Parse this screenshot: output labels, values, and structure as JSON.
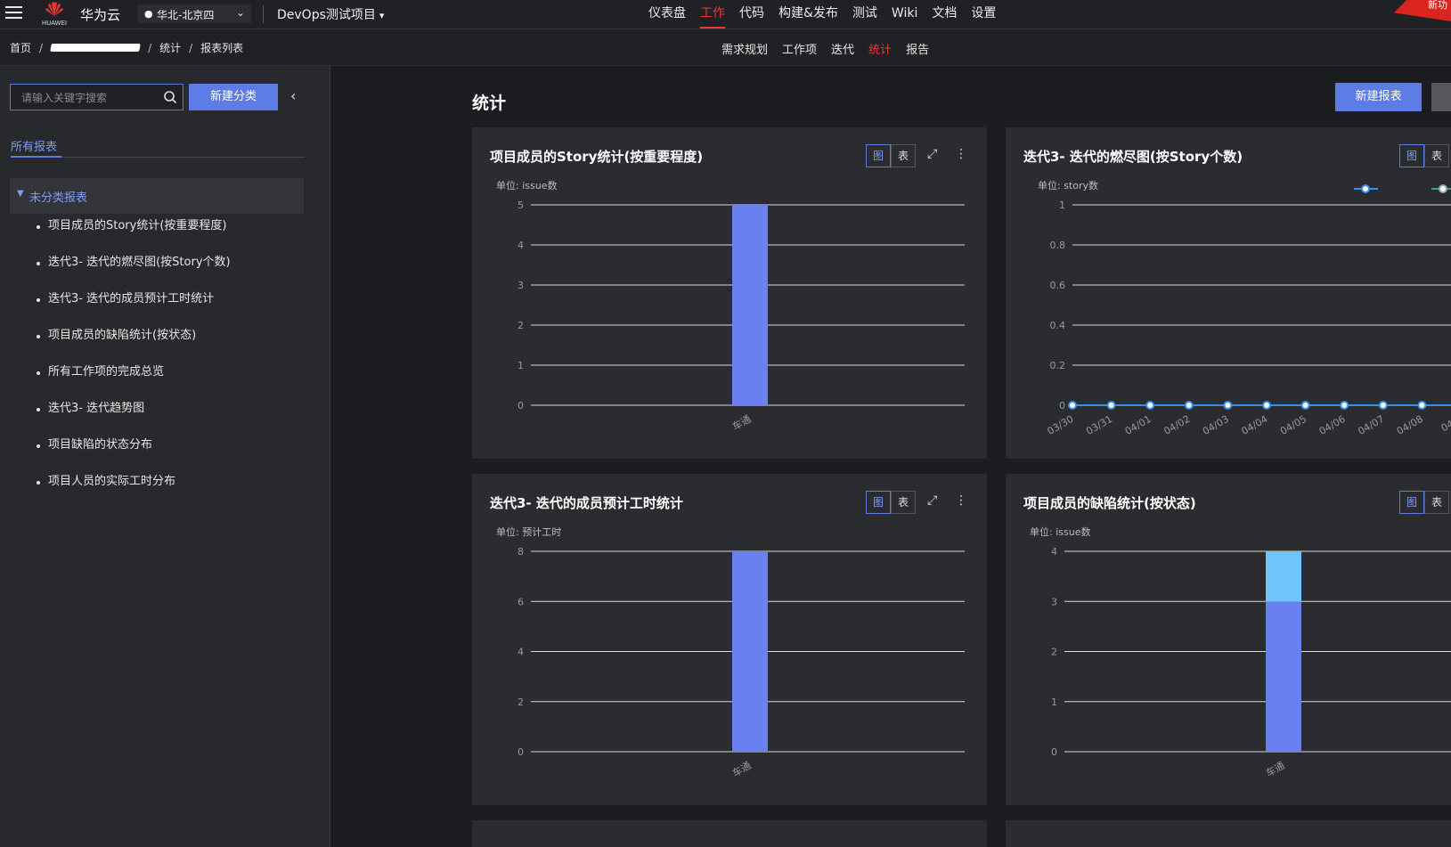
{
  "topbar": {
    "brand": "华为云",
    "logo_text": "HUAWEI",
    "region": "华北-北京四",
    "project": "DevOps测试项目",
    "nav": [
      {
        "label": "仪表盘",
        "active": false
      },
      {
        "label": "工作",
        "active": true
      },
      {
        "label": "代码",
        "active": false
      },
      {
        "label": "构建&发布",
        "active": false
      },
      {
        "label": "测试",
        "active": false
      },
      {
        "label": "Wiki",
        "active": false
      },
      {
        "label": "文档",
        "active": false
      },
      {
        "label": "设置",
        "active": false
      }
    ],
    "badge": "新功"
  },
  "breadcrumb": [
    "首页",
    "统计",
    "报表列表"
  ],
  "subnav": [
    {
      "label": "需求规划",
      "active": false
    },
    {
      "label": "工作项",
      "active": false
    },
    {
      "label": "迭代",
      "active": false
    },
    {
      "label": "统计",
      "active": true
    },
    {
      "label": "报告",
      "active": false
    }
  ],
  "sidebar": {
    "search_placeholder": "请输入关键字搜索",
    "new_category": "新建分类",
    "tab_all": "所有报表",
    "group": "未分类报表",
    "reports": [
      "项目成员的Story统计(按重要程度)",
      "迭代3- 迭代的燃尽图(按Story个数)",
      "迭代3- 迭代的成员预计工时统计",
      "项目成员的缺陷统计(按状态)",
      "所有工作项的完成总览",
      "迭代3- 迭代趋势图",
      "项目缺陷的状态分布",
      "项目人员的实际工时分布"
    ]
  },
  "main": {
    "title": "统计",
    "new_report": "新建报表",
    "toggle_chart": "图",
    "toggle_table": "表"
  },
  "colors": {
    "accent": "#5d7ce6",
    "bar": "#6a7ff0",
    "bar_light": "#6fc4fb",
    "active_red": "#e8373a",
    "line": "#3a8ee6"
  },
  "chart_data": [
    {
      "type": "bar",
      "title": "项目成员的Story统计(按重要程度)",
      "unit": "单位: issue数",
      "categories": [
        "车通"
      ],
      "series": [
        {
          "values": [
            5
          ]
        }
      ],
      "yticks": [
        0,
        1,
        2,
        3,
        4,
        5
      ],
      "ylim": [
        0,
        5
      ]
    },
    {
      "type": "line",
      "title": "迭代3- 迭代的燃尽图(按Story个数)",
      "unit": "单位: story数",
      "x": [
        "03/30",
        "03/31",
        "04/01",
        "04/02",
        "04/03",
        "04/04",
        "04/05",
        "04/06",
        "04/07",
        "04/08",
        "04/0"
      ],
      "series": [
        {
          "values": [
            0,
            0,
            0,
            0,
            0,
            0,
            0,
            0,
            0,
            0,
            0
          ]
        }
      ],
      "yticks": [
        0,
        0.2,
        0.4,
        0.6,
        0.8,
        1
      ],
      "ylim": [
        0,
        1
      ],
      "legend": "top-right"
    },
    {
      "type": "bar",
      "title": "迭代3- 迭代的成员预计工时统计",
      "unit": "单位: 预计工时",
      "categories": [
        "车通"
      ],
      "series": [
        {
          "values": [
            8
          ]
        }
      ],
      "yticks": [
        0,
        2,
        4,
        6,
        8
      ],
      "ylim": [
        0,
        8
      ]
    },
    {
      "type": "bar",
      "title": "项目成员的缺陷统计(按状态)",
      "unit": "单位: issue数",
      "categories": [
        "车通"
      ],
      "series": [
        {
          "values": [
            3
          ]
        },
        {
          "values": [
            1
          ]
        }
      ],
      "stacked": true,
      "yticks": [
        0,
        1,
        2,
        3,
        4
      ],
      "ylim": [
        0,
        4
      ]
    }
  ]
}
